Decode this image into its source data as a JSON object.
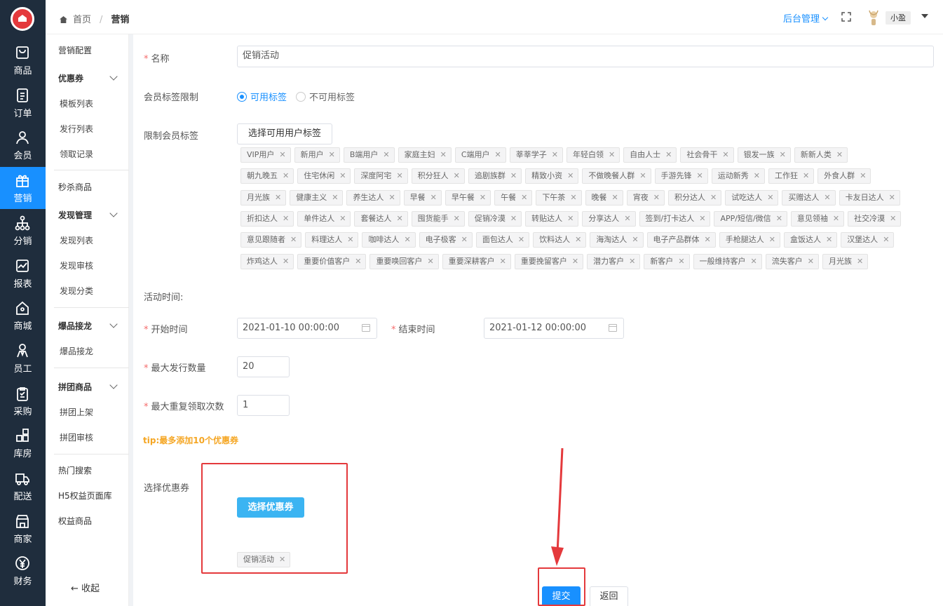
{
  "rail": [
    {
      "label": "商品",
      "icon": "bag-icon"
    },
    {
      "label": "订单",
      "icon": "order-icon"
    },
    {
      "label": "会员",
      "icon": "user-icon"
    },
    {
      "label": "营销",
      "icon": "gift-icon"
    },
    {
      "label": "分销",
      "icon": "network-icon"
    },
    {
      "label": "报表",
      "icon": "chart-icon"
    },
    {
      "label": "商城",
      "icon": "home-icon"
    },
    {
      "label": "员工",
      "icon": "staff-icon"
    },
    {
      "label": "采购",
      "icon": "clipboard-icon"
    },
    {
      "label": "库房",
      "icon": "warehouse-icon"
    },
    {
      "label": "配送",
      "icon": "truck-icon"
    },
    {
      "label": "商家",
      "icon": "shop-icon"
    },
    {
      "label": "财务",
      "icon": "yen-icon"
    }
  ],
  "menu2": {
    "items": [
      "营销配置",
      "优惠券",
      "模板列表",
      "发行列表",
      "领取记录",
      "秒杀商品",
      "发现管理",
      "发现列表",
      "发现审核",
      "发现分类",
      "爆品接龙",
      "爆品接龙",
      "拼团商品",
      "拼团上架",
      "拼团审核",
      "热门搜索",
      "H5权益页面库",
      "权益商品"
    ],
    "collapse": "收起"
  },
  "header": {
    "home": "首页",
    "sep": "/",
    "current": "营销",
    "admin": "后台管理",
    "user": "小盈"
  },
  "form": {
    "name_label": "名称",
    "name_value": "促销活动",
    "member_tag_limit_label": "会员标签限制",
    "radio_on": "可用标签",
    "radio_off": "不可用标签",
    "restrict_tag_label": "限制会员标签",
    "choose_tag_button": "选择可用用户标签",
    "tag_rows": [
      [
        "VIP用户",
        "新用户",
        "B端用户",
        "家庭主妇",
        "C端用户",
        "莘莘学子",
        "年轻白领",
        "自由人士",
        "社会骨干",
        "银发一族",
        "新新人类"
      ],
      [
        "朝九晚五",
        "住宅休闲",
        "深度阿宅",
        "积分狂人",
        "追剧族群",
        "精致小资",
        "不做晚餐人群",
        "手游先锋",
        "运动新秀",
        "工作狂",
        "外食人群"
      ],
      [
        "月光族",
        "健康主义",
        "养生达人",
        "早餐",
        "早午餐",
        "午餐",
        "下午茶",
        "晚餐",
        "宵夜",
        "积分达人",
        "试吃达人",
        "买赠达人",
        "卡友日达人"
      ],
      [
        "折扣达人",
        "单件达人",
        "套餐达人",
        "囤货能手",
        "促销冷漠",
        "转贴达人",
        "分享达人",
        "签到/打卡达人",
        "APP/短信/微信",
        "意见领袖",
        "社交冷漠"
      ],
      [
        "意见跟随者",
        "料理达人",
        "咖啡达人",
        "电子极客",
        "面包达人",
        "饮料达人",
        "海淘达人",
        "电子产品群体",
        "手枪腿达人",
        "盒饭达人",
        "汉堡达人"
      ],
      [
        "炸鸡达人",
        "重要价值客户",
        "重要唤回客户",
        "重要深耕客户",
        "重要挽留客户",
        "潜力客户",
        "新客户",
        "一般维持客户",
        "流失客户",
        "月光族"
      ]
    ],
    "activity_time_label": "活动时间:",
    "start_label": "开始时间",
    "start_value": "2021-01-10 00:00:00",
    "end_label": "结束时间",
    "end_value": "2021-01-12 00:00:00",
    "max_issue_label": "最大发行数量",
    "max_issue_value": "20",
    "max_repeat_label": "最大重复领取次数",
    "max_repeat_value": "1",
    "tip": "tip:最多添加10个优惠券",
    "coupon_label": "选择优惠券",
    "choose_coupon_button": "选择优惠券",
    "coupon_tag": "促销活动",
    "submit": "提交",
    "back": "返回"
  },
  "colors": {
    "accent": "#1890ff",
    "rail": "#1f2d3d",
    "highlight": "#e4393c",
    "tip": "#f5a623"
  }
}
